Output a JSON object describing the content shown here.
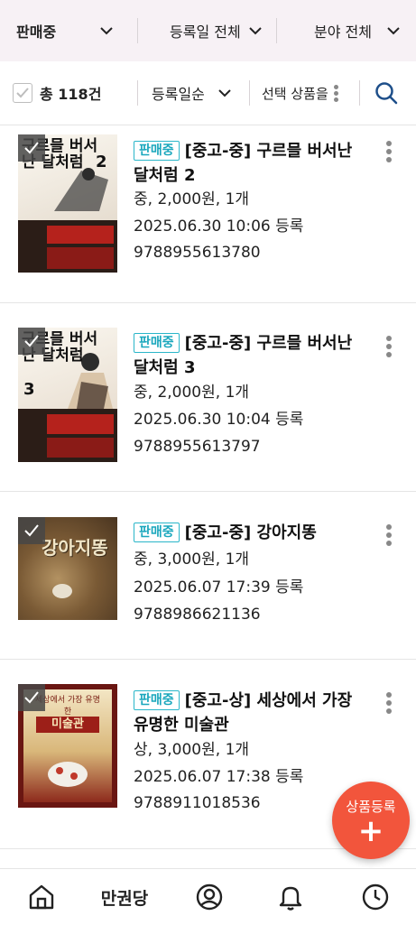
{
  "filters": {
    "status": "판매중",
    "date": "등록일 전체",
    "category": "분야 전체"
  },
  "toolbar": {
    "total": "총 118건",
    "sort": "등록일순",
    "select": "선택 상품을"
  },
  "items": [
    {
      "badge": "판매중",
      "title": "[중고-중] 구르믈 버서난 달처럼 2",
      "condition": "중, 2,000원, 1개",
      "date": "2025.06.30 10:06 등록",
      "isbn": "9788955613780",
      "cover_title": "구르믈 버서난 달처럼",
      "cover_vol": "2"
    },
    {
      "badge": "판매중",
      "title": "[중고-중] 구르믈 버서난 달처럼 3",
      "condition": "중, 2,000원, 1개",
      "date": "2025.06.30 10:04 등록",
      "isbn": "9788955613797",
      "cover_title": "구르믈 버서난 달처럼",
      "cover_vol": "3"
    },
    {
      "badge": "판매중",
      "title": "[중고-중] 강아지똥",
      "condition": "중, 3,000원, 1개",
      "date": "2025.06.07 17:39 등록",
      "isbn": "9788986621136",
      "cover_title": "강아지똥"
    },
    {
      "badge": "판매중",
      "title": "[중고-상] 세상에서 가장 유명한 미술관",
      "condition": "상, 3,000원, 1개",
      "date": "2025.06.07 17:38 등록",
      "isbn": "9788911018536",
      "cover_title": "미술관",
      "cover_small": "세상에서 가장 유명한"
    }
  ],
  "fab": {
    "label": "상품등록",
    "plus": "+"
  },
  "nav": {
    "store": "만권당"
  }
}
